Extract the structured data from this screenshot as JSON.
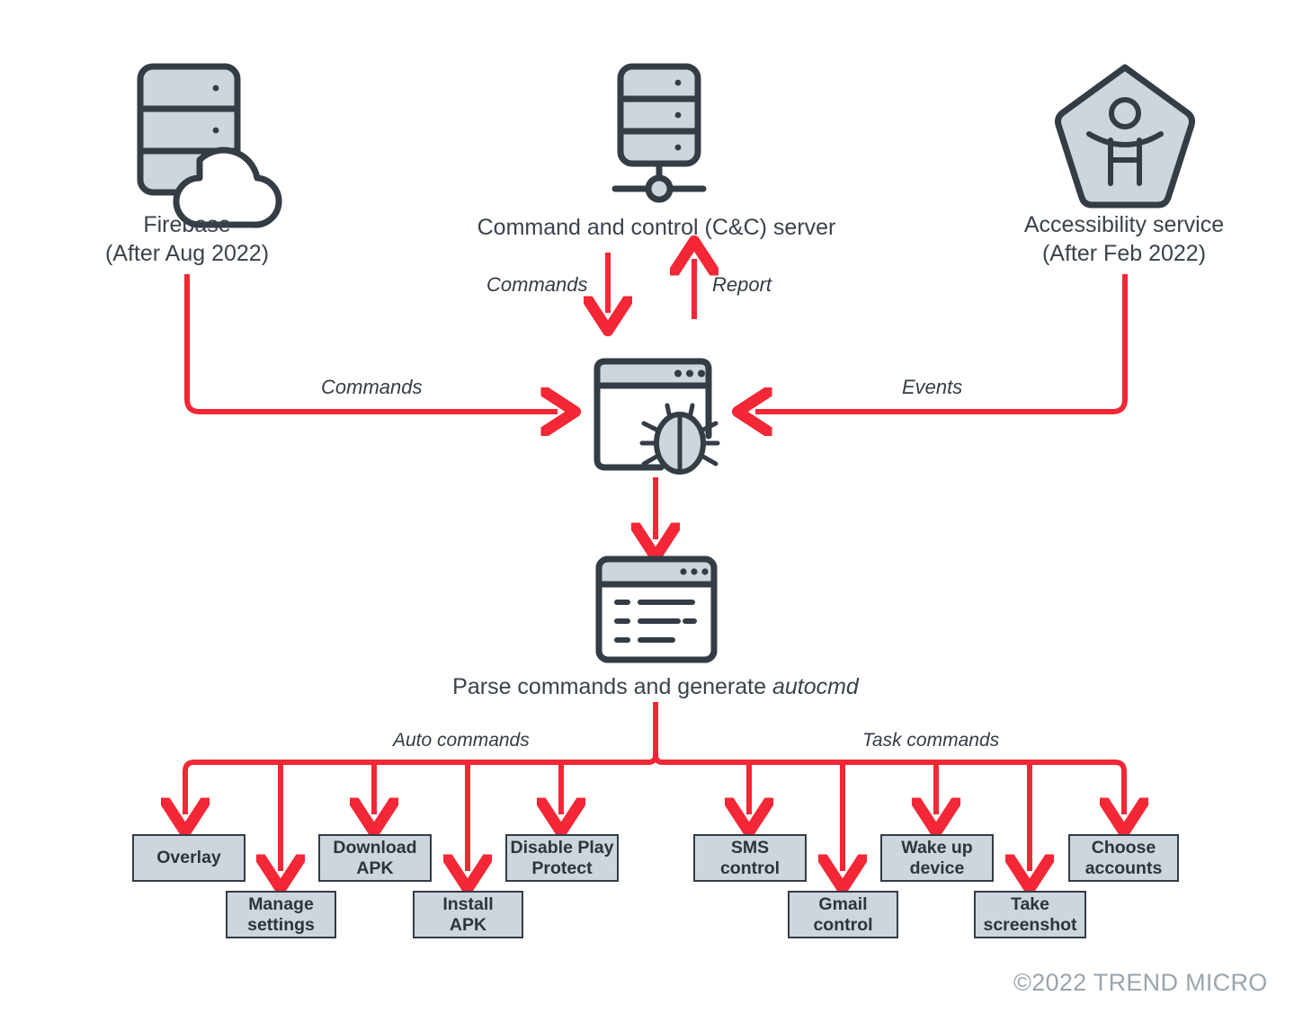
{
  "diagram": {
    "title_nodes": [
      {
        "id": "firebase",
        "label_line1": "Firebase",
        "label_line2": "(After Aug  2022)",
        "icon": "firebase-cloud-server-icon"
      },
      {
        "id": "cnc",
        "label_line1": "Command and control (C&C) server",
        "label_line2": "",
        "icon": "server-rack-icon"
      },
      {
        "id": "accessibility",
        "label_line1": "Accessibility service",
        "label_line2": "(After Feb 2022)",
        "icon": "accessibility-pentagon-icon"
      }
    ],
    "center_node": {
      "id": "malware",
      "icon": "browser-window-bug-icon",
      "label": ""
    },
    "parser_node": {
      "id": "parser",
      "icon": "browser-window-code-icon",
      "label_prefix": "Parse commands and generate ",
      "label_italic": "autocmd"
    },
    "edges": [
      {
        "id": "firebase-commands",
        "label": "Commands"
      },
      {
        "id": "cnc-commands",
        "label": "Commands"
      },
      {
        "id": "cnc-report",
        "label": "Report"
      },
      {
        "id": "accessibility-events",
        "label": "Events"
      },
      {
        "id": "auto-branch",
        "label": "Auto commands"
      },
      {
        "id": "task-branch",
        "label": "Task commands"
      }
    ],
    "command_groups": [
      {
        "group": "Auto commands",
        "boxes": [
          {
            "label": "Overlay",
            "row": "top"
          },
          {
            "label": "Manage settings",
            "row": "bottom"
          },
          {
            "label": "Download APK",
            "row": "top"
          },
          {
            "label": "Install APK",
            "row": "bottom"
          },
          {
            "label": "Disable Play Protect",
            "row": "top"
          }
        ]
      },
      {
        "group": "Task commands",
        "boxes": [
          {
            "label": "SMS control",
            "row": "top"
          },
          {
            "label": "Gmail control",
            "row": "bottom"
          },
          {
            "label": "Wake up device",
            "row": "top"
          },
          {
            "label": "Take screenshot",
            "row": "bottom"
          },
          {
            "label": "Choose accounts",
            "row": "top"
          }
        ]
      }
    ],
    "boxes_flat": [
      {
        "line1": "Overlay",
        "line2": ""
      },
      {
        "line1": "Manage",
        "line2": "settings"
      },
      {
        "line1": "Download",
        "line2": "APK"
      },
      {
        "line1": "Install",
        "line2": "APK"
      },
      {
        "line1": "Disable Play",
        "line2": "Protect"
      },
      {
        "line1": "SMS",
        "line2": "control"
      },
      {
        "line1": "Gmail",
        "line2": "control"
      },
      {
        "line1": "Wake up",
        "line2": "device"
      },
      {
        "line1": "Take",
        "line2": "screenshot"
      },
      {
        "line1": "Choose",
        "line2": "accounts"
      }
    ],
    "credit": "©2022 TREND MICRO",
    "colors": {
      "arrow_red": "#f32735",
      "icon_stroke": "#343c46",
      "icon_fill": "#ccd6dc",
      "box_fill": "#ccd6dc",
      "box_stroke": "#343c46",
      "text": "#3a424c",
      "credit_text": "#9aa5ad",
      "background": "#ffffff"
    }
  }
}
